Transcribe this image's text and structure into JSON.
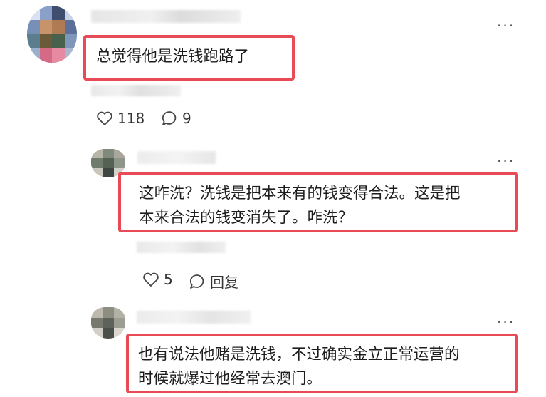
{
  "comments": [
    {
      "text": "总觉得他是洗钱跑路了",
      "likes": "118",
      "replies": "9",
      "more": "···",
      "like_icon": "heart-outline-icon",
      "reply_icon": "speech-bubble-icon"
    },
    {
      "text_line1": "这咋洗？洗钱是把本来有的钱变得合法。这是把",
      "text_line2": "本来合法的钱变消失了。咋洗？",
      "likes": "5",
      "reply_label": "回复",
      "more": "···"
    },
    {
      "text_line1": "也有说法他赌是洗钱，不过确实金立正常运营的",
      "text_line2": "时候就爆过他经常去澳门。",
      "more": "···"
    }
  ],
  "colors": {
    "highlight": "#e84b55",
    "icon": "#444444"
  }
}
